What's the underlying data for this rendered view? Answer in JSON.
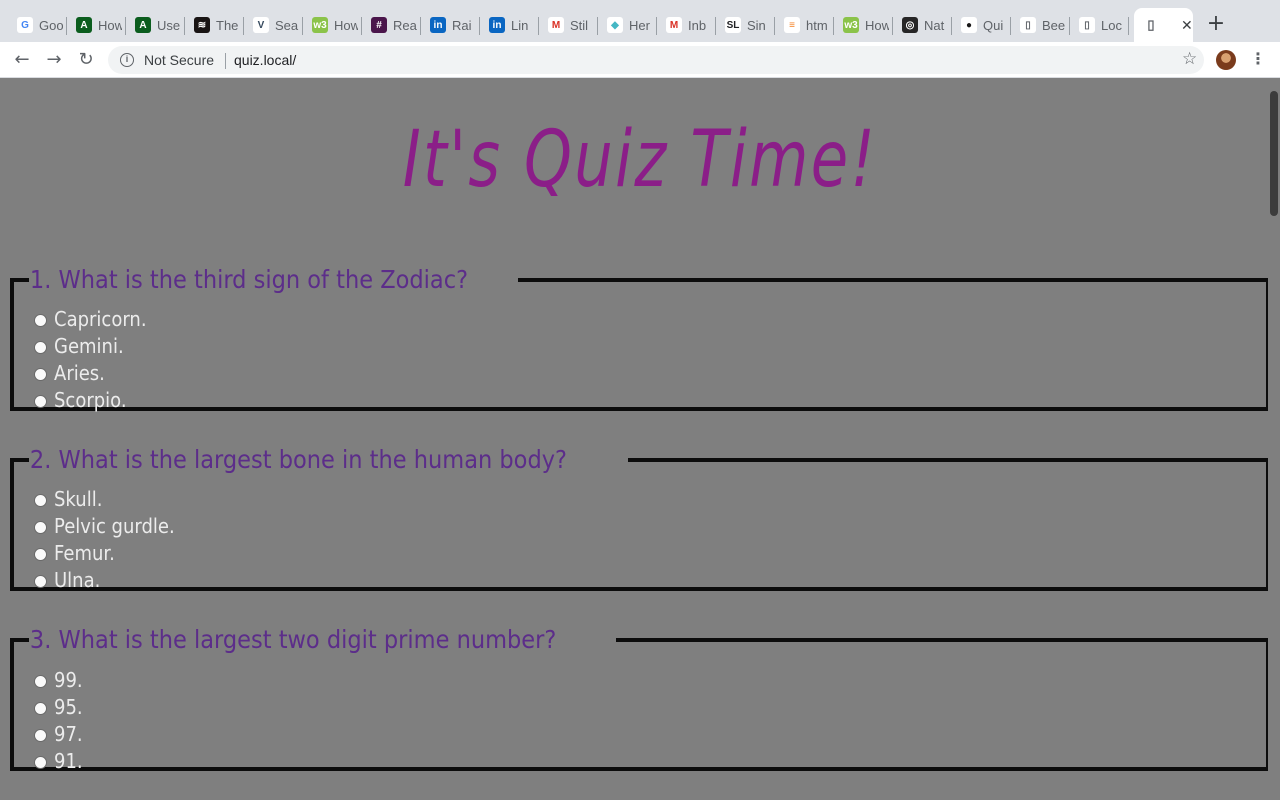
{
  "tabs": [
    {
      "title": "Goo",
      "icon": "google-icon",
      "color": "#ffffff",
      "glyph": "G",
      "fg": "#4285f4"
    },
    {
      "title": "How",
      "icon": "android-dev-icon",
      "color": "#0b5d1e",
      "glyph": "A",
      "fg": "#ffffff"
    },
    {
      "title": "Use",
      "icon": "android-dev-icon",
      "color": "#0b5d1e",
      "glyph": "A",
      "fg": "#ffffff"
    },
    {
      "title": "The",
      "icon": "spotify-icon",
      "color": "#191414",
      "glyph": "≋",
      "fg": "#ffffff"
    },
    {
      "title": "Sea",
      "icon": "vue-icon",
      "color": "#ffffff",
      "glyph": "V",
      "fg": "#35495e"
    },
    {
      "title": "How",
      "icon": "w3schools-icon",
      "color": "#8bc34a",
      "glyph": "w3",
      "fg": "#ffffff"
    },
    {
      "title": "Rea",
      "icon": "slack-hash-icon",
      "color": "#4a154b",
      "glyph": "#",
      "fg": "#ffffff"
    },
    {
      "title": "Rai",
      "icon": "linkedin-icon",
      "color": "#0a66c2",
      "glyph": "in",
      "fg": "#ffffff"
    },
    {
      "title": "Lin",
      "icon": "linkedin-icon",
      "color": "#0a66c2",
      "glyph": "in",
      "fg": "#ffffff"
    },
    {
      "title": "Stil",
      "icon": "gmail-icon",
      "color": "#ffffff",
      "glyph": "M",
      "fg": "#d93025"
    },
    {
      "title": "Her",
      "icon": "shield-icon",
      "color": "#ffffff",
      "glyph": "◆",
      "fg": "#45b7c4"
    },
    {
      "title": "Inb",
      "icon": "gmail-icon",
      "color": "#ffffff",
      "glyph": "M",
      "fg": "#d93025"
    },
    {
      "title": "Sin",
      "icon": "sl-icon",
      "color": "#ffffff",
      "glyph": "SL",
      "fg": "#202124"
    },
    {
      "title": "htm",
      "icon": "stackoverflow-icon",
      "color": "#ffffff",
      "glyph": "≡",
      "fg": "#f48024"
    },
    {
      "title": "How",
      "icon": "w3schools-icon",
      "color": "#8bc34a",
      "glyph": "w3",
      "fg": "#ffffff"
    },
    {
      "title": "Nat",
      "icon": "instagram-icon",
      "color": "#262626",
      "glyph": "◎",
      "fg": "#ffffff"
    },
    {
      "title": "Qui",
      "icon": "github-icon",
      "color": "#ffffff",
      "glyph": "●",
      "fg": "#181717"
    },
    {
      "title": "Bee",
      "icon": "document-icon",
      "color": "#ffffff",
      "glyph": "▯",
      "fg": "#5f6368"
    },
    {
      "title": "Loc",
      "icon": "document-icon",
      "color": "#ffffff",
      "glyph": "▯",
      "fg": "#5f6368"
    }
  ],
  "active_tab": {
    "title": "",
    "icon": "document-icon",
    "close_glyph": "✕"
  },
  "new_tab_glyph": "+",
  "toolbar": {
    "back_glyph": "←",
    "forward_glyph": "→",
    "reload_glyph": "↻",
    "info_glyph": "i",
    "security_label": "Not Secure",
    "url": "quiz.local/",
    "star_glyph": "☆",
    "menu_glyph": "⋮"
  },
  "page": {
    "title": "It's Quiz Time!",
    "questions": [
      {
        "legend": "1. What is the third sign of the Zodiac?",
        "options": [
          "Capricorn.",
          "Gemini.",
          "Aries.",
          "Scorpio."
        ]
      },
      {
        "legend": "2. What is the largest bone in the human body?",
        "options": [
          "Skull.",
          "Pelvic gurdle.",
          "Femur.",
          "Ulna."
        ]
      },
      {
        "legend": "3. What is the largest two digit prime number?",
        "options": [
          "99.",
          "95.",
          "97.",
          "91."
        ]
      }
    ]
  }
}
